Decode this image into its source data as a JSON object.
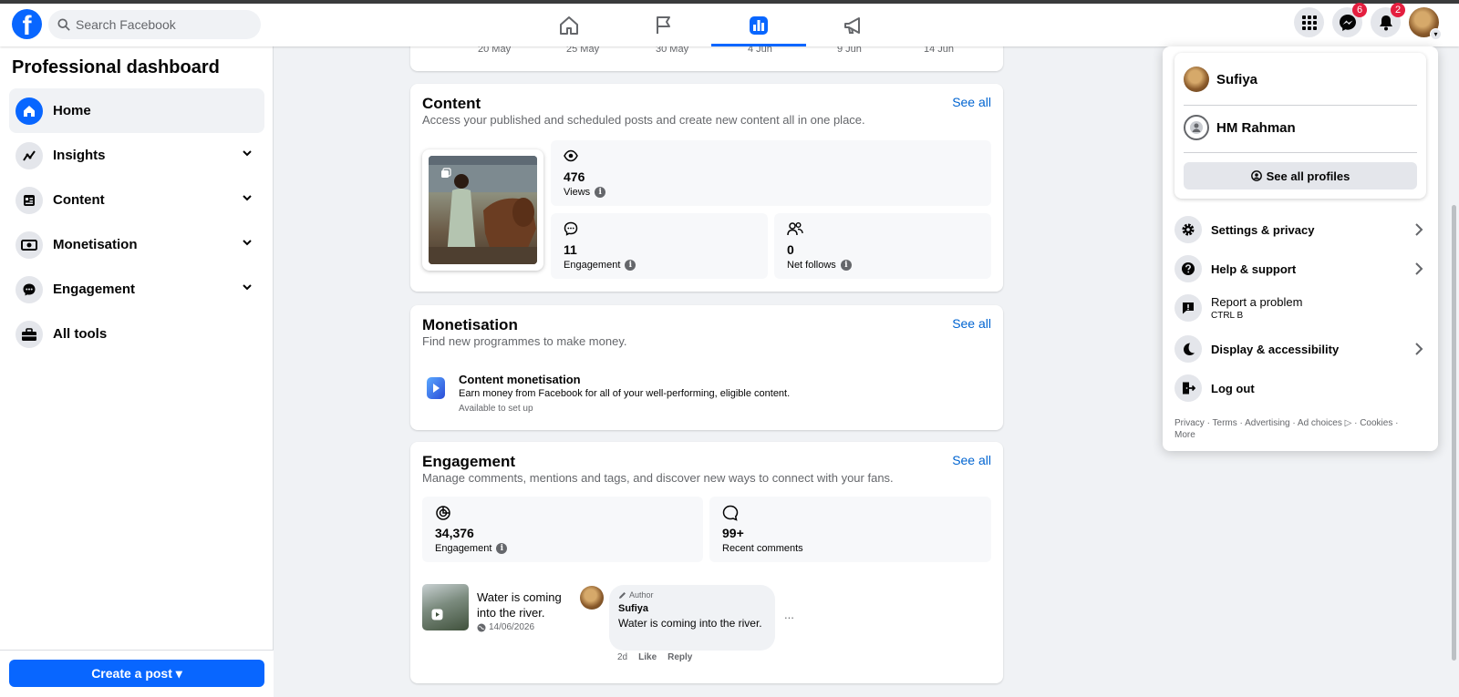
{
  "header": {
    "search_placeholder": "Search Facebook",
    "messenger_badge": "6",
    "notifications_badge": "2",
    "nav_tabs": [
      "home",
      "pages",
      "professional-dashboard",
      "ads"
    ]
  },
  "sidebar": {
    "title": "Professional dashboard",
    "items": [
      {
        "label": "Home",
        "icon": "home-icon",
        "active": true
      },
      {
        "label": "Insights",
        "icon": "insights-icon",
        "expandable": true
      },
      {
        "label": "Content",
        "icon": "content-icon",
        "expandable": true
      },
      {
        "label": "Monetisation",
        "icon": "monetisation-icon",
        "expandable": true
      },
      {
        "label": "Engagement",
        "icon": "engagement-icon",
        "expandable": true
      },
      {
        "label": "All tools",
        "icon": "toolbox-icon"
      }
    ],
    "create_post_label": "Create a post"
  },
  "chart_axis": {
    "dates": [
      "20 May",
      "25 May",
      "30 May",
      "4 Jun",
      "9 Jun",
      "14 Jun"
    ]
  },
  "content": {
    "title": "Content",
    "see_all": "See all",
    "subtitle": "Access your published and scheduled posts and create new content all in one place.",
    "views_value": "476",
    "views_label": "Views",
    "engagement_value": "11",
    "engagement_label": "Engagement",
    "follows_value": "0",
    "follows_label": "Net follows"
  },
  "monetisation": {
    "title": "Monetisation",
    "see_all": "See all",
    "subtitle": "Find new programmes to make money.",
    "item_title": "Content monetisation",
    "item_desc": "Earn money from Facebook for all of your well-performing, eligible content.",
    "item_status": "Available to set up"
  },
  "engagement": {
    "title": "Engagement",
    "see_all": "See all",
    "subtitle": "Manage comments, mentions and tags, and discover new ways to connect with your fans.",
    "engagement_value": "34,376",
    "engagement_label": "Engagement",
    "comments_value": "99+",
    "comments_label": "Recent comments",
    "post_text": "Water is coming into the river.",
    "post_date": "14/06/2026",
    "comment_role": "Author",
    "comment_author": "Sufiya",
    "comment_text": "Water is coming into the river.",
    "comment_age": "2d",
    "like_label": "Like",
    "reply_label": "Reply",
    "more_label": "..."
  },
  "account_menu": {
    "profiles": [
      "Sufiya",
      "HM Rahman"
    ],
    "see_all_profiles": "See all profiles",
    "items": [
      {
        "label": "Settings & privacy",
        "icon": "gear-icon",
        "chevron": true
      },
      {
        "label": "Help & support",
        "icon": "help-icon",
        "chevron": true
      },
      {
        "label": "Report a problem",
        "sub": "CTRL B",
        "icon": "report-icon"
      },
      {
        "label": "Display & accessibility",
        "icon": "moon-icon",
        "chevron": true
      },
      {
        "label": "Log out",
        "icon": "logout-icon"
      }
    ],
    "footer": {
      "privacy": "Privacy",
      "terms": "Terms",
      "advertising": "Advertising",
      "ad_choices": "Ad choices",
      "cookies": "Cookies",
      "more": "More"
    }
  },
  "colors": {
    "brand": "#0866ff",
    "link": "#0064d1",
    "badge": "#e41e3f"
  }
}
